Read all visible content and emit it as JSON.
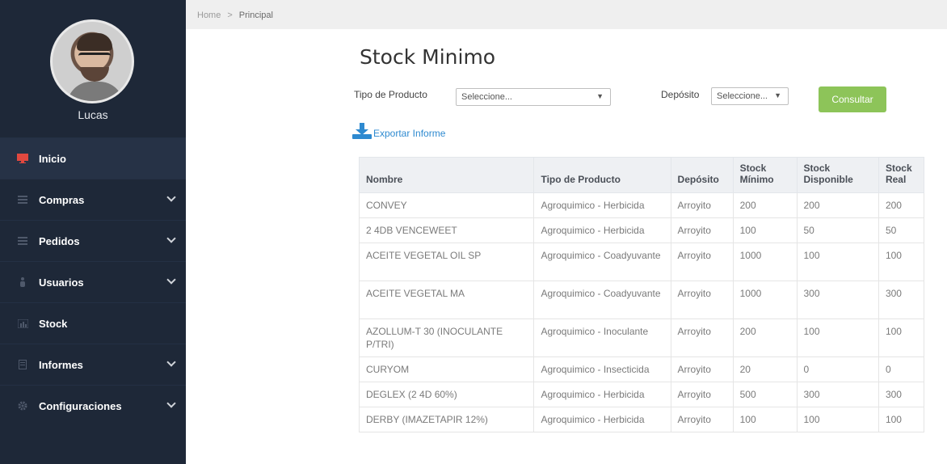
{
  "sidebar": {
    "username": "Lucas",
    "items": [
      {
        "label": "Inicio",
        "icon": "monitor-icon",
        "active": true
      },
      {
        "label": "Compras",
        "icon": "list-icon",
        "expandable": true
      },
      {
        "label": "Pedidos",
        "icon": "list-icon",
        "expandable": true
      },
      {
        "label": "Usuarios",
        "icon": "user-icon",
        "expandable": true
      },
      {
        "label": "Stock",
        "icon": "chart-icon"
      },
      {
        "label": "Informes",
        "icon": "document-icon",
        "expandable": true
      },
      {
        "label": "Configuraciones",
        "icon": "gear-icon",
        "expandable": true
      }
    ]
  },
  "breadcrumb": {
    "home": "Home",
    "separator": ">",
    "current": "Principal"
  },
  "page": {
    "title": "Stock Minimo"
  },
  "filters": {
    "tipo_label": "Tipo de Producto",
    "tipo_value": "Seleccione...",
    "deposito_label": "Depósito",
    "deposito_value": "Seleccione...",
    "consultar": "Consultar"
  },
  "export_label": "Exportar Informe",
  "table": {
    "headers": [
      "Nombre",
      "Tipo de Producto",
      "Depósito",
      "Stock Mínimo",
      "Stock Disponible",
      "Stock Real"
    ],
    "rows": [
      [
        "CONVEY",
        "Agroquimico - Herbicida",
        "Arroyito",
        "200",
        "200",
        "200"
      ],
      [
        "2 4DB VENCEWEET",
        "Agroquimico - Herbicida",
        "Arroyito",
        "100",
        "50",
        "50"
      ],
      [
        "ACEITE VEGETAL OIL SP",
        "Agroquimico - Coadyuvante",
        "Arroyito",
        "1000",
        "100",
        "100"
      ],
      [
        "ACEITE VEGETAL MA",
        "Agroquimico - Coadyuvante",
        "Arroyito",
        "1000",
        "300",
        "300"
      ],
      [
        "AZOLLUM-T 30 (INOCULANTE P/TRI)",
        "Agroquimico - Inoculante",
        "Arroyito",
        "200",
        "100",
        "100"
      ],
      [
        "CURYOM",
        "Agroquimico - Insecticida",
        "Arroyito",
        "20",
        "0",
        "0"
      ],
      [
        "DEGLEX (2 4D 60%)",
        "Agroquimico - Herbicida",
        "Arroyito",
        "500",
        "300",
        "300"
      ],
      [
        "DERBY (IMAZETAPIR 12%)",
        "Agroquimico - Herbicida",
        "Arroyito",
        "100",
        "100",
        "100"
      ]
    ]
  },
  "colors": {
    "sidebar_bg": "#1e2838",
    "active_icon": "#e0483f",
    "button": "#8dc459",
    "link": "#2e8ad0"
  }
}
